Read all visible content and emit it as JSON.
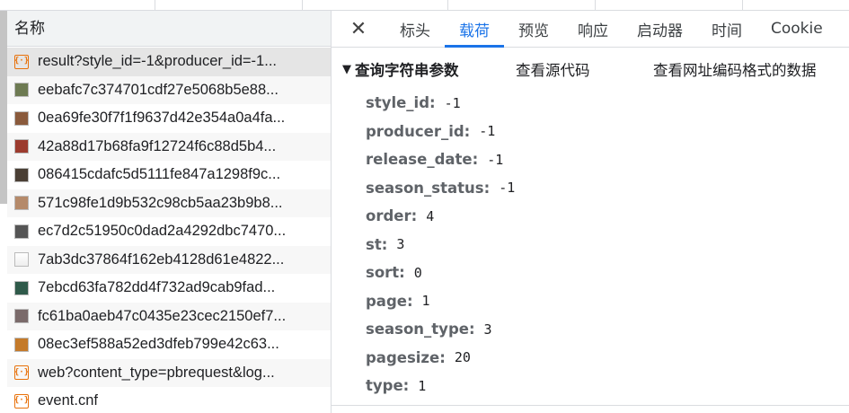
{
  "requests_panel": {
    "column_header": "名称",
    "items": [
      {
        "name": "result?style_id=-1&producer_id=-1...",
        "icon": "code-icon",
        "selected": true
      },
      {
        "name": "eebafc7c374701cdf27e5068b5e88...",
        "icon": "image-thumbnail-icon",
        "thumb": "#6d7a52"
      },
      {
        "name": "0ea69fe30f7f1f9637d42e354a0a4fa...",
        "icon": "image-thumbnail-icon",
        "thumb": "#8a5a3c"
      },
      {
        "name": "42a88d17b68fa9f12724f6c88d5b4...",
        "icon": "image-thumbnail-icon",
        "thumb": "#9c3b2e"
      },
      {
        "name": "086415cdafc5d5111fe847a1298f9c...",
        "icon": "image-thumbnail-icon",
        "thumb": "#4a3f35"
      },
      {
        "name": "571c98fe1d9b532c98cb5aa23b9b8...",
        "icon": "image-thumbnail-icon",
        "thumb": "#b58a6a"
      },
      {
        "name": "ec7d2c51950c0dad2a4292dbc7470...",
        "icon": "image-thumbnail-icon",
        "thumb": "#555555"
      },
      {
        "name": "7ab3dc37864f162eb4128d61e4822...",
        "icon": "document-icon",
        "thumb": "#d8d8d8"
      },
      {
        "name": "7ebcd63fa782dd4f732ad9cab9fad...",
        "icon": "image-thumbnail-icon",
        "thumb": "#2f5a4a"
      },
      {
        "name": "fc61ba0aeb47c0435e23cec2150ef7...",
        "icon": "image-thumbnail-icon",
        "thumb": "#7a6a6a"
      },
      {
        "name": "08ec3ef588a52ed3dfeb799e42c63...",
        "icon": "image-thumbnail-icon",
        "thumb": "#c47a2a"
      },
      {
        "name": "web?content_type=pbrequest&log...",
        "icon": "code-icon"
      },
      {
        "name": "event.cnf",
        "icon": "code-icon"
      }
    ]
  },
  "detail_panel": {
    "close_symbol": "✕",
    "tabs": [
      {
        "label": "标头",
        "active": false
      },
      {
        "label": "载荷",
        "active": true
      },
      {
        "label": "预览",
        "active": false
      },
      {
        "label": "响应",
        "active": false
      },
      {
        "label": "启动器",
        "active": false
      },
      {
        "label": "时间",
        "active": false
      },
      {
        "label": "Cookie",
        "active": false
      }
    ],
    "section": {
      "arrow": "▼",
      "title": "查询字符串参数",
      "view_source": "查看源代码",
      "view_url_encoded": "查看网址编码格式的数据"
    },
    "params": [
      {
        "key": "style_id:",
        "value": "-1"
      },
      {
        "key": "producer_id:",
        "value": "-1"
      },
      {
        "key": "release_date:",
        "value": "-1"
      },
      {
        "key": "season_status:",
        "value": "-1"
      },
      {
        "key": "order:",
        "value": "4"
      },
      {
        "key": "st:",
        "value": "3"
      },
      {
        "key": "sort:",
        "value": "0"
      },
      {
        "key": "page:",
        "value": "1"
      },
      {
        "key": "season_type:",
        "value": "3"
      },
      {
        "key": "pagesize:",
        "value": "20"
      },
      {
        "key": "type:",
        "value": "1"
      }
    ]
  },
  "colors": {
    "accent": "#1a73e8",
    "code_icon": "#e8710a",
    "selected_row": "#e5e5e5"
  }
}
